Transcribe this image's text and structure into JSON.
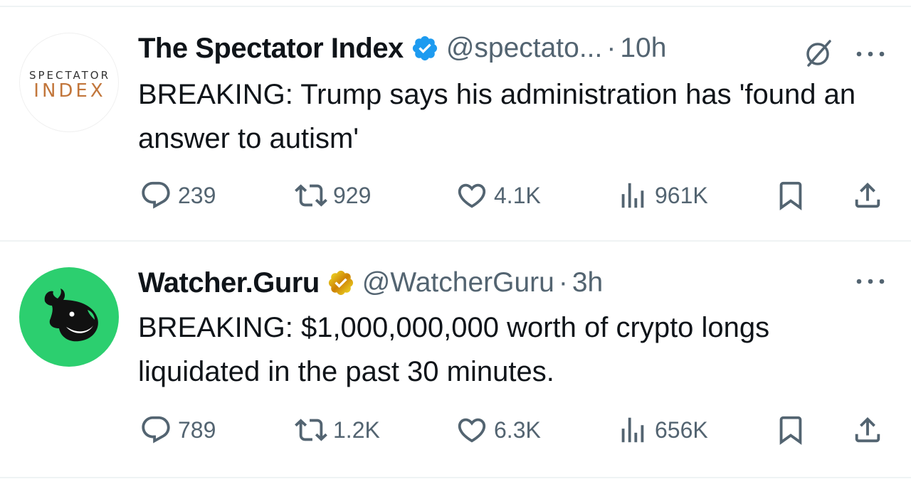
{
  "tweets": [
    {
      "avatar_text_top": "SPECTATOR",
      "avatar_text_bottom": "INDEX",
      "name": "The Spectator Index",
      "verified": "blue-check",
      "handle": "@spectato...",
      "separator": "·",
      "time": "10h",
      "text": "BREAKING: Trump says his administration has 'found an answer to autism'",
      "replies": "239",
      "retweets": "929",
      "likes": "4.1K",
      "views": "961K"
    },
    {
      "name": "Watcher.Guru",
      "verified": "gold-check",
      "handle": "@WatcherGuru",
      "separator": "·",
      "time": "3h",
      "text": "BREAKING: $1,000,000,000 worth of crypto longs liquidated in the past 30 minutes.",
      "replies": "789",
      "retweets": "1.2K",
      "likes": "6.3K",
      "views": "656K"
    }
  ],
  "colors": {
    "text": "#0f1419",
    "secondary": "#536471",
    "verified_blue": "#1d9bf0",
    "verified_gold": "#e2b719",
    "watcher_green": "#2ccf6f",
    "spectator_orange": "#c2763b",
    "divider": "#eff3f4"
  },
  "icons": [
    "reply-icon",
    "retweet-icon",
    "like-icon",
    "views-icon",
    "bookmark-icon",
    "share-icon",
    "more-icon",
    "grok-icon",
    "verified-badge-icon"
  ]
}
